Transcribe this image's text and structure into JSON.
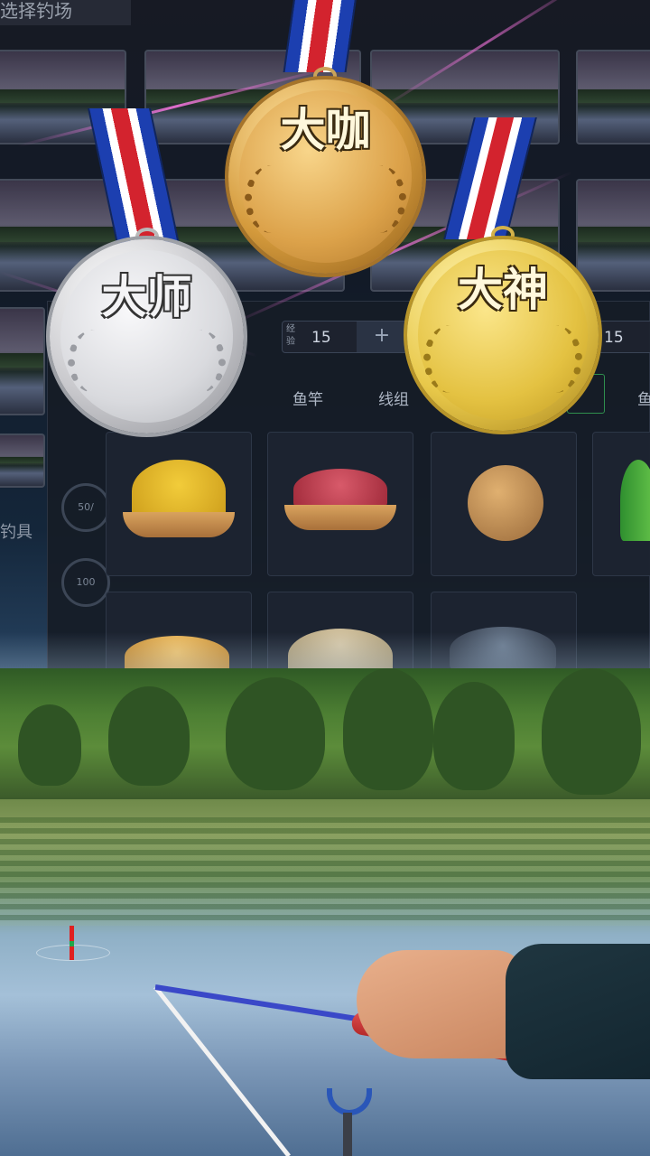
{
  "header": {
    "title": "选择钓场"
  },
  "tabs": [
    {
      "label": "鱼竿"
    },
    {
      "label": "线组"
    },
    {
      "label": "鱼"
    }
  ],
  "steppers": [
    {
      "label": "经验",
      "value": "15",
      "plus": "+"
    },
    {
      "value": "15"
    }
  ],
  "side_label": "钓具",
  "rings": [
    {
      "value": "50/"
    },
    {
      "value": "100"
    }
  ],
  "medals": [
    {
      "id": "silver",
      "text": "大师",
      "color": "#dcdcdc"
    },
    {
      "id": "bronze-gold",
      "text": "大咖",
      "color": "#d49a3c"
    },
    {
      "id": "gold",
      "text": "大神",
      "color": "#e8c84a"
    }
  ],
  "baits": [
    {
      "icon": "corn-meal-bait-icon"
    },
    {
      "icon": "red-pellet-bait-icon"
    },
    {
      "icon": "bait-ball-icon"
    },
    {
      "icon": "water-plant-icon"
    },
    {
      "icon": "corn-kernel-bait-icon"
    },
    {
      "icon": "powder-bait-icon"
    },
    {
      "icon": "dark-pellet-bait-icon"
    }
  ],
  "colors": {
    "accent_green": "#2f8f4e",
    "ribbon_red": "#d3232e",
    "ribbon_blue": "#1c3fb0"
  }
}
